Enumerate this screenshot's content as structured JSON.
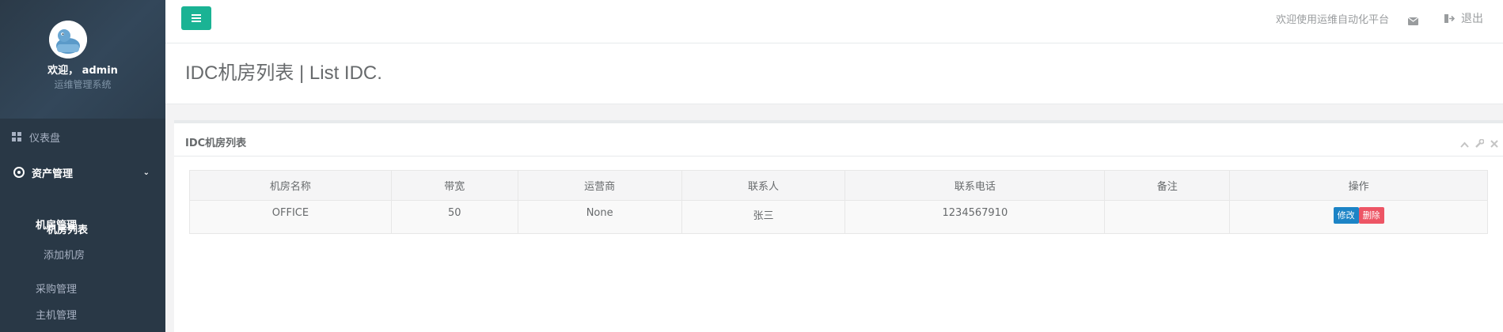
{
  "colors": {
    "sidebar_bg": "#2f4050",
    "primary": "#1ab394",
    "edit_button": "#1c84c6",
    "delete_button": "#ed5565"
  },
  "sidebar": {
    "welcome": "欢迎， admin",
    "subtitle": "运维管理系统",
    "items": [
      {
        "label": "仪表盘",
        "icon": "dashboard-icon"
      },
      {
        "label": "资产管理",
        "icon": "rebel-icon",
        "expanded": true,
        "children": [
          {
            "label": "机房管理",
            "expanded": true,
            "children": [
              {
                "label": "机房列表",
                "active": true
              },
              {
                "label": "添加机房"
              }
            ]
          },
          {
            "label": "采购管理"
          },
          {
            "label": "主机管理"
          }
        ]
      }
    ]
  },
  "topbar": {
    "welcome_text": "欢迎使用运维自动化平台",
    "logout_label": "退出"
  },
  "page": {
    "heading": "IDC机房列表 | List IDC."
  },
  "panel": {
    "title": "IDC机房列表"
  },
  "table": {
    "headers": [
      "机房名称",
      "带宽",
      "运营商",
      "联系人",
      "联系电话",
      "备注",
      "操作"
    ],
    "rows": [
      {
        "name": "OFFICE",
        "bandwidth": "50",
        "operator": "None",
        "contact": "张三",
        "phone": "1234567910",
        "remark": "",
        "edit_label": "修改",
        "delete_label": "删除"
      }
    ]
  }
}
